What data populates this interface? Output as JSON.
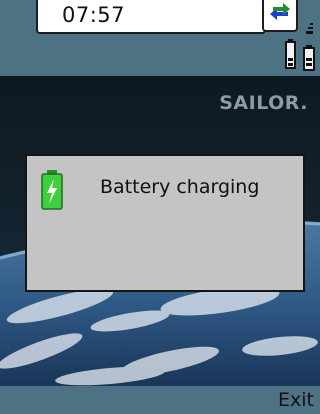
{
  "status_bar": {
    "time": "07:57",
    "sync_icon": "sync-arrows-icon",
    "signal_icon": "signal-strength-icon",
    "battery_icon": "battery-level-icon",
    "color": "#4d7283"
  },
  "wallpaper": {
    "logo": "SAILOR."
  },
  "dialog": {
    "icon": "battery-charging-icon",
    "message": "Battery charging"
  },
  "softkeys": {
    "right_label": "Exit"
  },
  "colors": {
    "dialog_bg": "#c4c4c4",
    "battery_green": "#3fcf3f"
  }
}
